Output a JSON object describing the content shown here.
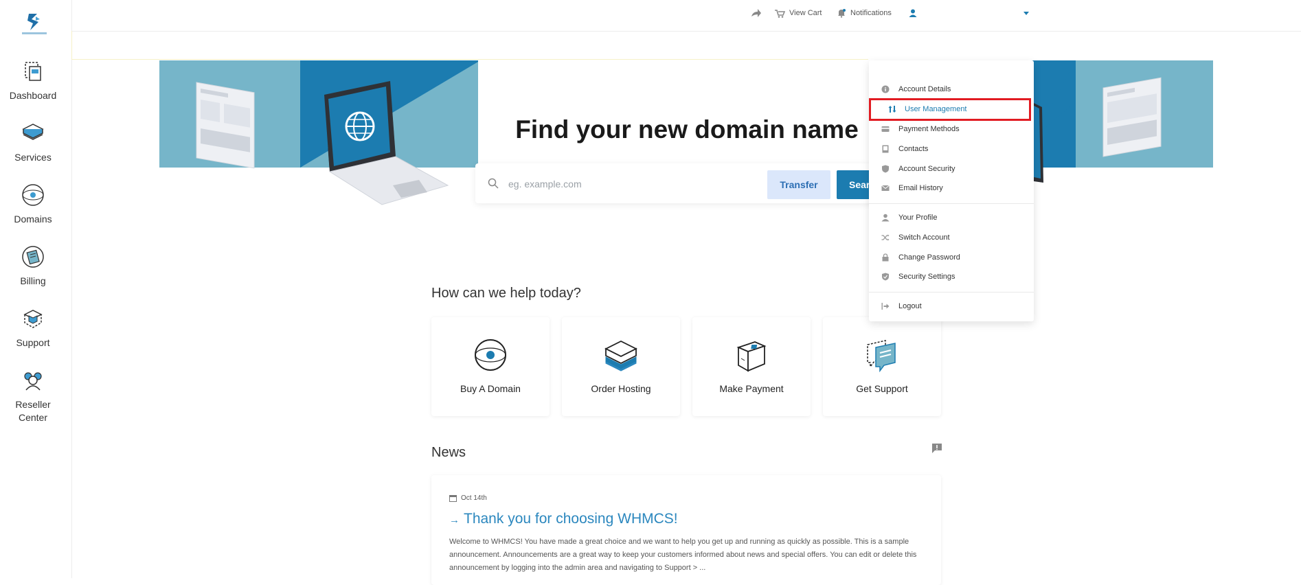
{
  "sidebar": {
    "items": [
      {
        "label": "Dashboard",
        "icon": "dashboard-icon"
      },
      {
        "label": "Services",
        "icon": "services-icon"
      },
      {
        "label": "Domains",
        "icon": "domains-icon"
      },
      {
        "label": "Billing",
        "icon": "billing-icon"
      },
      {
        "label": "Support",
        "icon": "support-icon"
      },
      {
        "label": "Reseller Center",
        "icon": "reseller-center-icon"
      }
    ]
  },
  "topbar": {
    "view_cart": "View Cart",
    "notifications": "Notifications"
  },
  "hero": {
    "title": "Find your new domain name",
    "search_placeholder": "eg. example.com",
    "transfer_label": "Transfer",
    "search_label": "Sear"
  },
  "help": {
    "heading": "How can we help today?",
    "cards": [
      {
        "label": "Buy A Domain",
        "icon": "globe-icon"
      },
      {
        "label": "Order Hosting",
        "icon": "server-stack-icon"
      },
      {
        "label": "Make Payment",
        "icon": "payment-box-icon"
      },
      {
        "label": "Get Support",
        "icon": "chat-bubbles-icon"
      }
    ]
  },
  "news": {
    "heading": "News",
    "date": "Oct 14th",
    "title": "Thank you for choosing WHMCS!",
    "body": "Welcome to WHMCS! You have made a great choice and we want to help you get up and running as quickly as possible. This is a sample announcement. Announcements are a great way to keep your customers informed about news and special offers. You can edit or delete this announcement by logging into the admin area and navigating to Support > ..."
  },
  "dropdown": {
    "items": [
      {
        "label": "Account Details",
        "icon": "info-circle-icon"
      },
      {
        "label": "User Management",
        "icon": "swap-arrows-icon"
      },
      {
        "label": "Payment Methods",
        "icon": "credit-card-icon"
      },
      {
        "label": "Contacts",
        "icon": "address-book-icon"
      },
      {
        "label": "Account Security",
        "icon": "shield-icon"
      },
      {
        "label": "Email History",
        "icon": "envelope-icon"
      },
      {
        "label": "Your Profile",
        "icon": "user-icon"
      },
      {
        "label": "Switch Account",
        "icon": "shuffle-icon"
      },
      {
        "label": "Change Password",
        "icon": "lock-icon"
      },
      {
        "label": "Security Settings",
        "icon": "shield-check-icon"
      },
      {
        "label": "Logout",
        "icon": "logout-icon"
      }
    ]
  },
  "colors": {
    "brand_blue": "#1c7cb0",
    "link_blue": "#2b87be",
    "highlight_red": "#e11b22",
    "hero_light": "#76b5c9"
  }
}
